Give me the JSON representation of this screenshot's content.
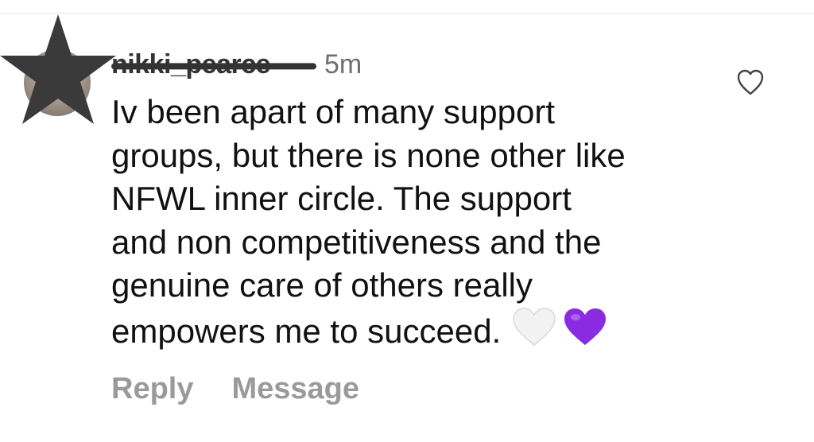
{
  "comment": {
    "username": "nikki_pearce",
    "timestamp": "5m",
    "text_lines": [
      "Iv been apart of many support",
      "groups, but there is none other like",
      "NFWL inner circle. The support",
      "and non competitiveness and the",
      "genuine care of others really",
      "empowers me to succeed."
    ],
    "emojis": [
      "white-heart",
      "purple-heart"
    ]
  },
  "actions": {
    "reply_label": "Reply",
    "message_label": "Message"
  },
  "icons": {
    "like": "heart-outline-icon",
    "redaction": "star-icon"
  },
  "colors": {
    "text": "#111111",
    "meta": "#6f6f6f",
    "actions": "#9a9a9a",
    "purple_heart": "#8a2be2"
  }
}
